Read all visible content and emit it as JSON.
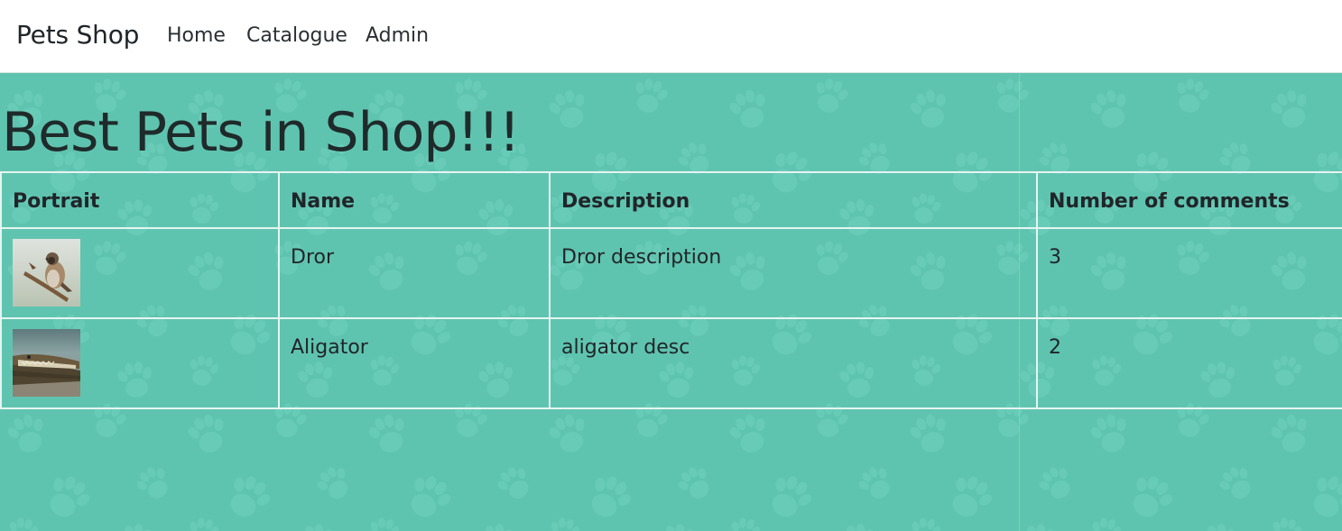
{
  "navbar": {
    "brand": "Pets Shop",
    "links": [
      {
        "label": "Home"
      },
      {
        "label": "Catalogue"
      },
      {
        "label": "Admin"
      }
    ]
  },
  "page": {
    "title": "Best Pets in Shop!!!"
  },
  "table": {
    "headers": {
      "portrait": "Portrait",
      "name": "Name",
      "description": "Description",
      "comments": "Number of comments"
    },
    "rows": [
      {
        "name": "Dror",
        "description": "Dror description",
        "comments": "3",
        "image": "sparrow-photo"
      },
      {
        "name": "Aligator",
        "description": "aligator desc",
        "comments": "2",
        "image": "alligator-photo"
      }
    ]
  },
  "colors": {
    "background": "#5fc4af",
    "paw_pattern": "#6fd1bd",
    "text": "#212529",
    "table_border": "#e6f4f1"
  }
}
